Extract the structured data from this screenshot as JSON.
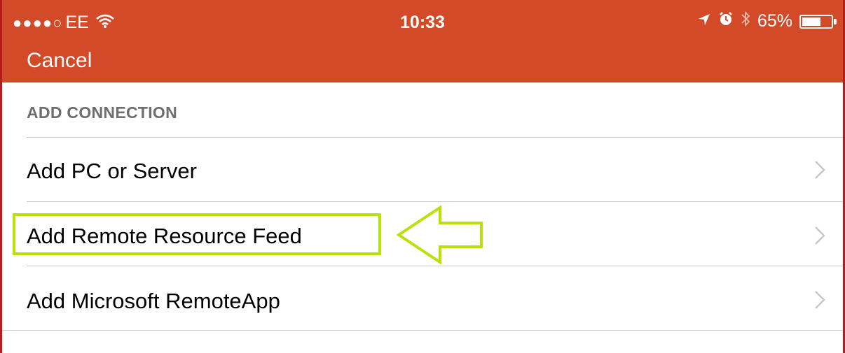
{
  "status_bar": {
    "signal_dots": "●●●●○",
    "carrier": "EE",
    "time": "10:33",
    "battery_percent": "65%",
    "battery_level": 0.65,
    "icons": [
      "wifi-icon",
      "location-arrow-icon",
      "alarm-icon",
      "bluetooth-icon",
      "battery-icon"
    ]
  },
  "nav": {
    "cancel_label": "Cancel"
  },
  "section": {
    "header": "ADD CONNECTION"
  },
  "items": [
    {
      "label": "Add PC or Server"
    },
    {
      "label": "Add Remote Resource Feed"
    },
    {
      "label": "Add Microsoft RemoteApp"
    }
  ],
  "colors": {
    "header_bg": "#d24a27",
    "highlight": "#b9e20b",
    "separator": "#c8c7cc",
    "section_text": "#6d6d72",
    "chevron": "#c7c7cc"
  }
}
